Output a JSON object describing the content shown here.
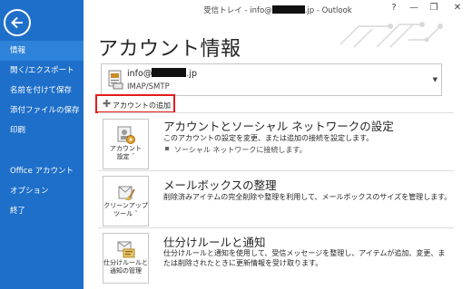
{
  "window": {
    "title_prefix": "受信トレイ - info@",
    "title_suffix": ".jp - Outlook",
    "help": "?",
    "minimize": "—",
    "restore": "❐",
    "close": "✕"
  },
  "sidebar": {
    "back_icon": "back-arrow-icon",
    "items": [
      {
        "label": "情報",
        "active": true
      },
      {
        "label": "開く/エクスポート"
      },
      {
        "label": "名前を付けて保存"
      },
      {
        "label": "添付ファイルの保存"
      },
      {
        "label": "印刷"
      },
      {
        "label": "Office アカウント"
      },
      {
        "label": "オプション"
      },
      {
        "label": "終了"
      }
    ]
  },
  "main": {
    "title": "アカウント情報",
    "account": {
      "email_prefix": "info@",
      "email_suffix": ".jp",
      "type": "IMAP/SMTP",
      "dropdown": "▼"
    },
    "add_account_plus": "✚",
    "add_account": "アカウントの追加",
    "sections": [
      {
        "tile_label": [
          "アカウント",
          "設定 ˇ"
        ],
        "title": "アカウントとソーシャル ネットワークの設定",
        "desc": "このアカウントの設定を変更、または追加の接続を設定します。",
        "bullet": "ソーシャル ネットワークに接続します。"
      },
      {
        "tile_label": [
          "クリーンアップ",
          "ツール ˇ"
        ],
        "title": "メールボックスの整理",
        "desc": "削除済みアイテムの完全削除や整理を利用して、メールボックスのサイズを管理します。"
      },
      {
        "tile_label": [
          "仕分けルールと",
          "通知の管理"
        ],
        "title": "仕分けルールと通知",
        "desc": "仕分けルールと通知を使用して、受信メッセージを整理し、アイテムが追加、変更、または削除されたときに更新情報を受け取ります。"
      }
    ]
  },
  "colors": {
    "sidebar": "#1e6fc9",
    "sidebar_active": "#2c83d9",
    "highlight_border": "#e31c1c"
  }
}
